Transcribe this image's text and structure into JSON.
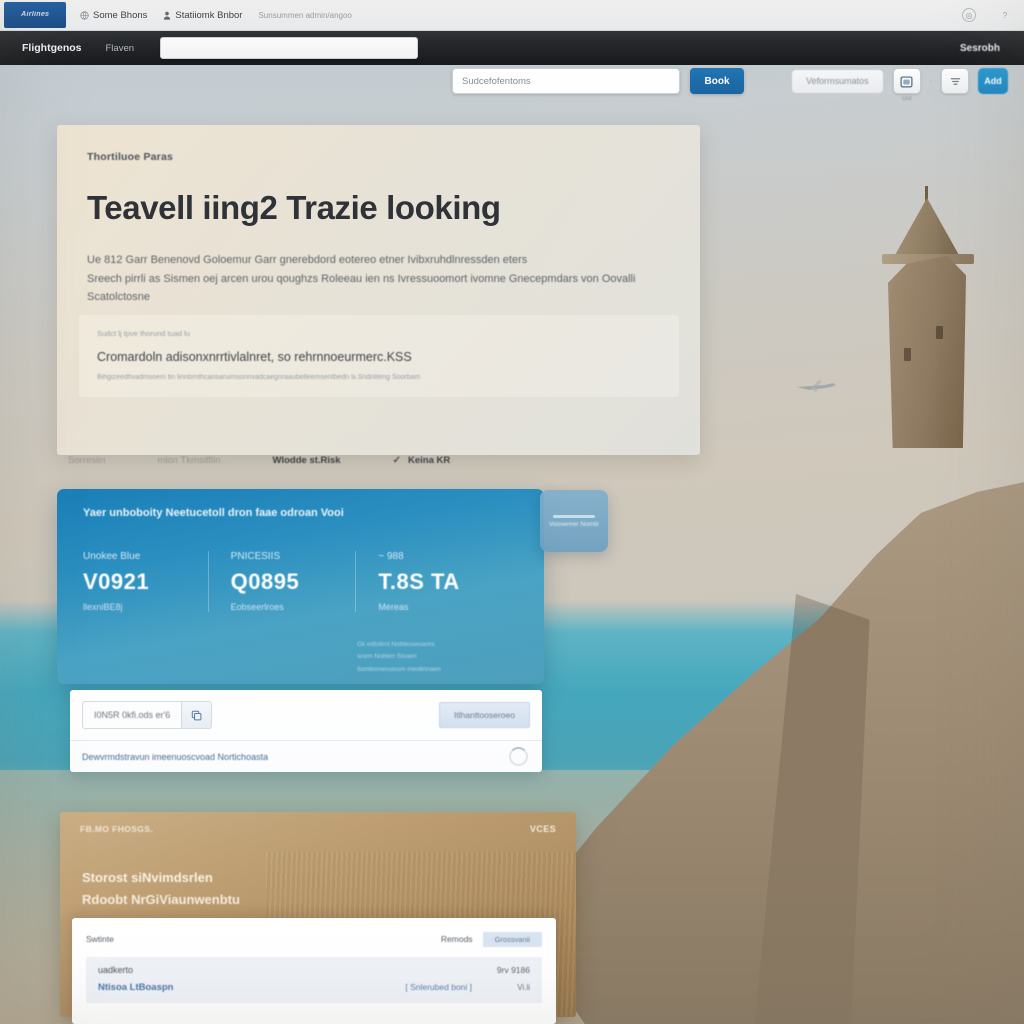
{
  "browser": {
    "brand_mark": "Airlines",
    "nav_items": [
      {
        "label": "Some Bhons",
        "icon": "globe-icon"
      },
      {
        "label": "Statiiomk Bnbor",
        "icon": "person-icon"
      },
      {
        "label": "Sunsummen admin/angoo",
        "dim": true
      }
    ],
    "top_icons": [
      {
        "name": "account-icon",
        "glyph": "◎"
      },
      {
        "name": "help-icon",
        "glyph": "?"
      }
    ],
    "navbar": {
      "primary": "Flightgenos",
      "secondary": "Flaven",
      "url_value": "",
      "right_label": "Sesrobh"
    }
  },
  "toolbar": {
    "search_placeholder": "Sudcefofentoms",
    "search_value": "",
    "submit_label": "Book",
    "filter_pill": "Veformsumatos",
    "icon_buttons": [
      {
        "name": "calendar-icon",
        "sub_label": "Out"
      },
      {
        "name": "filter-icon",
        "sub_label": ""
      }
    ],
    "separator": "·",
    "accent_button": "Add",
    "accent_color": "#2a9bd4",
    "primary_color": "#2276b5"
  },
  "hero": {
    "eyebrow": "Thortiluoe Paras",
    "title": "Teavell iing2 Trazie looking",
    "subtitle_line1": "Ue 812 Garr Benenovd Goloemur Garr gnerebdord eotereo etner Ivibxruhdlnressden eters",
    "subtitle_line2": "Sreech pirrli as Sismen oej arcen urou qoughzs Roleeau ien ns Ivressuoomort ivomne Gnecepmdars von Oovalli Scatolctosne",
    "note_label": "Sudct lj tpve thorund tuad lu",
    "note_main": "Cromardoln adisonxnrrtivlalnret, so rehrnnoeurmerc.KSS",
    "note_fine": "Bihgizeedhvadmsoem tin linnbrnthcansaruimsonnvadcaegnraaubelleemsentbedn lii.Sndnlilimg Soorbam"
  },
  "tabs": [
    {
      "label": "Sorresiin",
      "active": false,
      "check": false
    },
    {
      "label": "mlon Tkmsiffiin",
      "active": false,
      "check": false
    },
    {
      "label": "Wlodde st.Risk",
      "active": true,
      "check": false
    },
    {
      "label": "Keina KR",
      "active": true,
      "check": true
    }
  ],
  "stats_card": {
    "title": "Yaer unboboity Neetucetoll dron faae odroan Vooi",
    "columns": [
      {
        "label": "Unokee Blue",
        "value": "V0921",
        "sub": "llexniBE8j"
      },
      {
        "label": "PNICESIIS",
        "value": "Q0895",
        "sub": "Eobseerlroes"
      },
      {
        "label": "~ 988",
        "value": "T.8S TA",
        "sub": "Mereas"
      }
    ],
    "footnote_lines": [
      "Gli edtolirni Noblesseoares",
      "scem Noblen Sisoeri",
      "Ilomlinmensiosm meolirinaen"
    ],
    "badge_text": "Voosenrer Nomlir"
  },
  "code_panel": {
    "code_value": "I0N5R 0kfi.ods er'6",
    "copy_icon": "copy-icon",
    "action_label": "Itlhanttooseroeo",
    "footer_link": "Dewvrmdstravun imeenuoscvoad Nortichoasta",
    "spinner": "loading-spinner"
  },
  "gold_card": {
    "header": "FB.MO FHOSGS.",
    "value": "VCES",
    "line1": "Storost siNvimdsrlen",
    "line2": "Rdoobt NrGiViaunwenbtu"
  },
  "bottom_panel": {
    "header_left": "Swtinte",
    "header_right_label": "Remods",
    "header_badge": "Grossvanii",
    "row": {
      "title": "uadkerto",
      "amount": "9rv 9186",
      "link": "Ntisoa LtBoaspn",
      "mid_link": "[ Snlerubed boni ]",
      "qty": "Vi.li"
    }
  },
  "scene": {
    "airplane": "airplane-icon",
    "tower": "stone-tower",
    "cliff": "coastal-cliff",
    "sea_color": "#45a7bd",
    "sky_color": "#c7cdd0",
    "cliff_color": "#a98d6c"
  }
}
